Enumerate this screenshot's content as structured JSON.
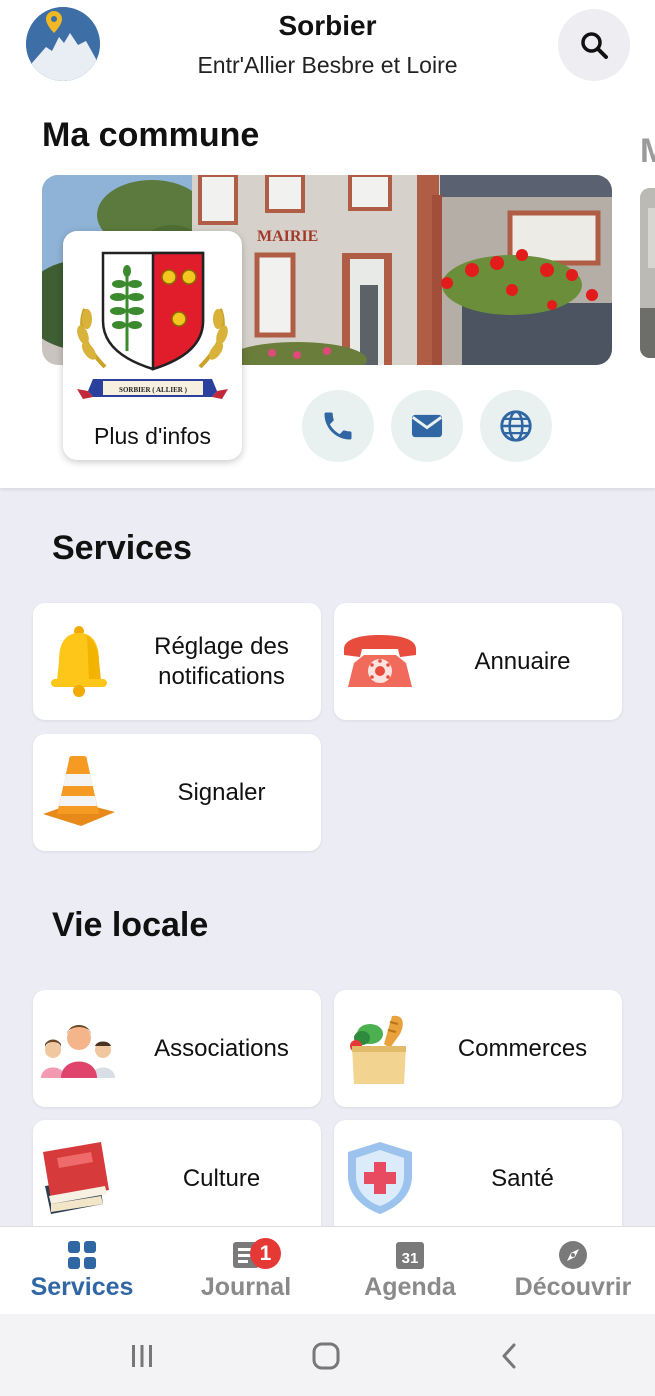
{
  "header": {
    "title": "Sorbier",
    "subtitle": "Entr'Allier Besbre et Loire"
  },
  "commune": {
    "section_title": "Ma commune",
    "next_section_peek": "M",
    "banner_sign": "MAIRIE",
    "crest_scroll": "SORBIER ( ALLIER )",
    "more_info_label": "Plus d'infos",
    "actions": [
      {
        "icon": "phone-icon"
      },
      {
        "icon": "mail-icon"
      },
      {
        "icon": "globe-icon"
      }
    ]
  },
  "services": {
    "section_title": "Services",
    "tiles": [
      {
        "label": "Réglage des notifications",
        "icon": "bell-icon"
      },
      {
        "label": "Annuaire",
        "icon": "telephone-icon"
      },
      {
        "label": "Signaler",
        "icon": "traffic-cone-icon"
      }
    ]
  },
  "vie_locale": {
    "section_title": "Vie locale",
    "tiles": [
      {
        "label": "Associations",
        "icon": "people-icon"
      },
      {
        "label": "Commerces",
        "icon": "grocery-bag-icon"
      },
      {
        "label": "Culture",
        "icon": "books-icon"
      },
      {
        "label": "Santé",
        "icon": "health-shield-icon"
      }
    ]
  },
  "bottom_nav": {
    "items": [
      {
        "label": "Services",
        "icon": "grid-icon",
        "active": true
      },
      {
        "label": "Journal",
        "icon": "newspaper-icon",
        "badge": "1"
      },
      {
        "label": "Agenda",
        "icon": "calendar-icon",
        "day": "31"
      },
      {
        "label": "Découvrir",
        "icon": "compass-icon"
      }
    ]
  },
  "colors": {
    "accent": "#2f66a3",
    "background": "#ececf4",
    "inactive_nav": "#8a8a8a",
    "badge": "#e53935"
  }
}
